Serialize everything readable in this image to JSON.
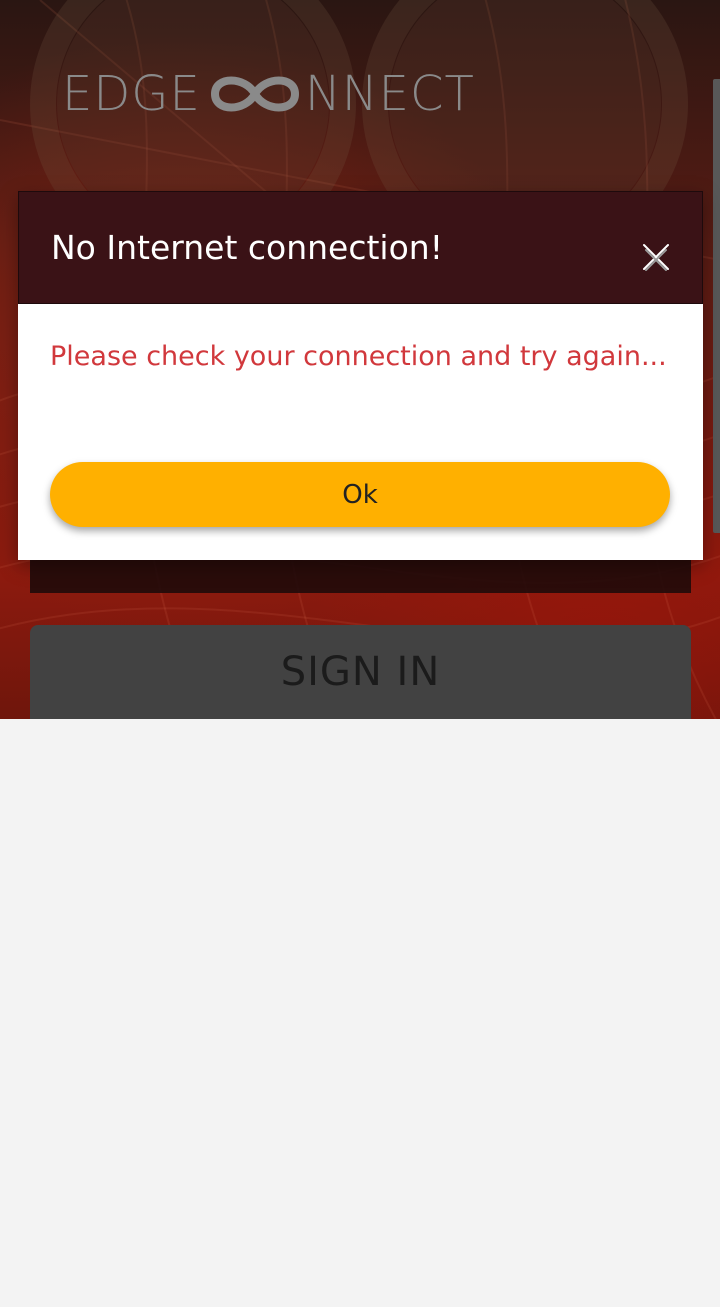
{
  "logo": {
    "text_left": "EDGE",
    "text_right": "NNECT",
    "mark": "infinity-o-icon"
  },
  "dialog": {
    "title": "No Internet connection!",
    "close_icon": "close-icon",
    "message": "Please check your connection and try again...",
    "ok_label": "Ok"
  },
  "form": {
    "signin_label": "SIGN IN"
  },
  "colors": {
    "header_bg": "#3a1216",
    "message": "#d1383c",
    "ok_button": "#ffb000",
    "signin_button": "#424242",
    "logo": "#8a8a8a"
  }
}
